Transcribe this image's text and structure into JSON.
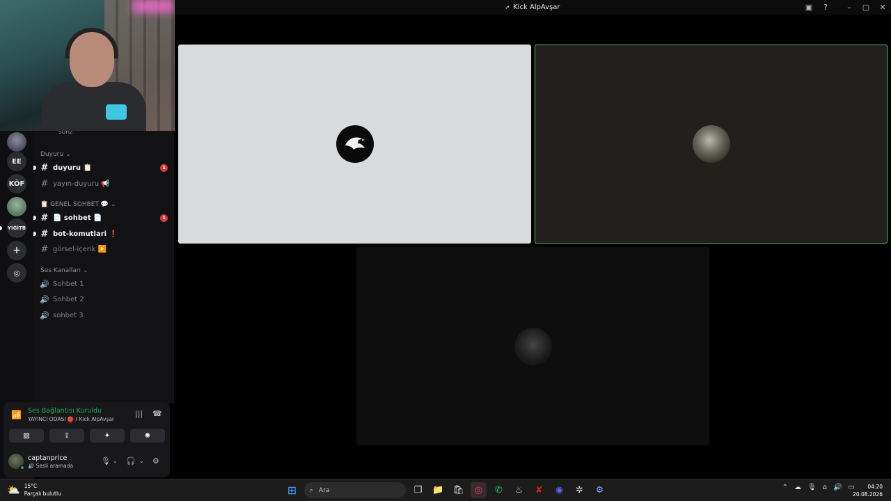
{
  "window": {
    "title": "Kick AlpAvşar"
  },
  "channels": {
    "partial_top": "sonz",
    "categories": [
      {
        "label": "Duyuru",
        "items": [
          {
            "label": "duyuru 📋",
            "unread": true,
            "badge": "1"
          },
          {
            "label": "yayın-duyuru 📢",
            "unread": false
          }
        ]
      },
      {
        "label": "📋 GENEL SOHBET 💬",
        "items": [
          {
            "label": "📄 sohbet 📄",
            "unread": true,
            "badge": "1"
          },
          {
            "label": "bot-komutlari ❗",
            "unread": true
          },
          {
            "label": "görsel-içerik ▶️",
            "unread": false
          }
        ]
      },
      {
        "label": "Ses Kanalları",
        "items": [
          {
            "label": "Sohbet 1"
          },
          {
            "label": "Sohbet 2"
          },
          {
            "label": "sohbet 3"
          }
        ]
      }
    ]
  },
  "servers": [
    {
      "label": ""
    },
    {
      "label": "EE"
    },
    {
      "label": "KÖF"
    },
    {
      "label": ""
    },
    {
      "label": "YİĞİTB"
    }
  ],
  "voice": {
    "status": "Ses Bağlantısı Kuruldu",
    "room": "YAYINCI ODASI 🔴 / Kick AlpAvşar"
  },
  "user": {
    "name": "captanprice",
    "status": "Sesli aramada"
  },
  "taskbar": {
    "weather_temp": "15°C",
    "weather_desc": "Parçalı bulutlu",
    "search_placeholder": "Ara",
    "time": "04:20",
    "date": "20.08.2026"
  },
  "colors": {
    "speaking_border": "#3ec96d",
    "unread_badge": "#da373c",
    "connected": "#23a55a"
  }
}
